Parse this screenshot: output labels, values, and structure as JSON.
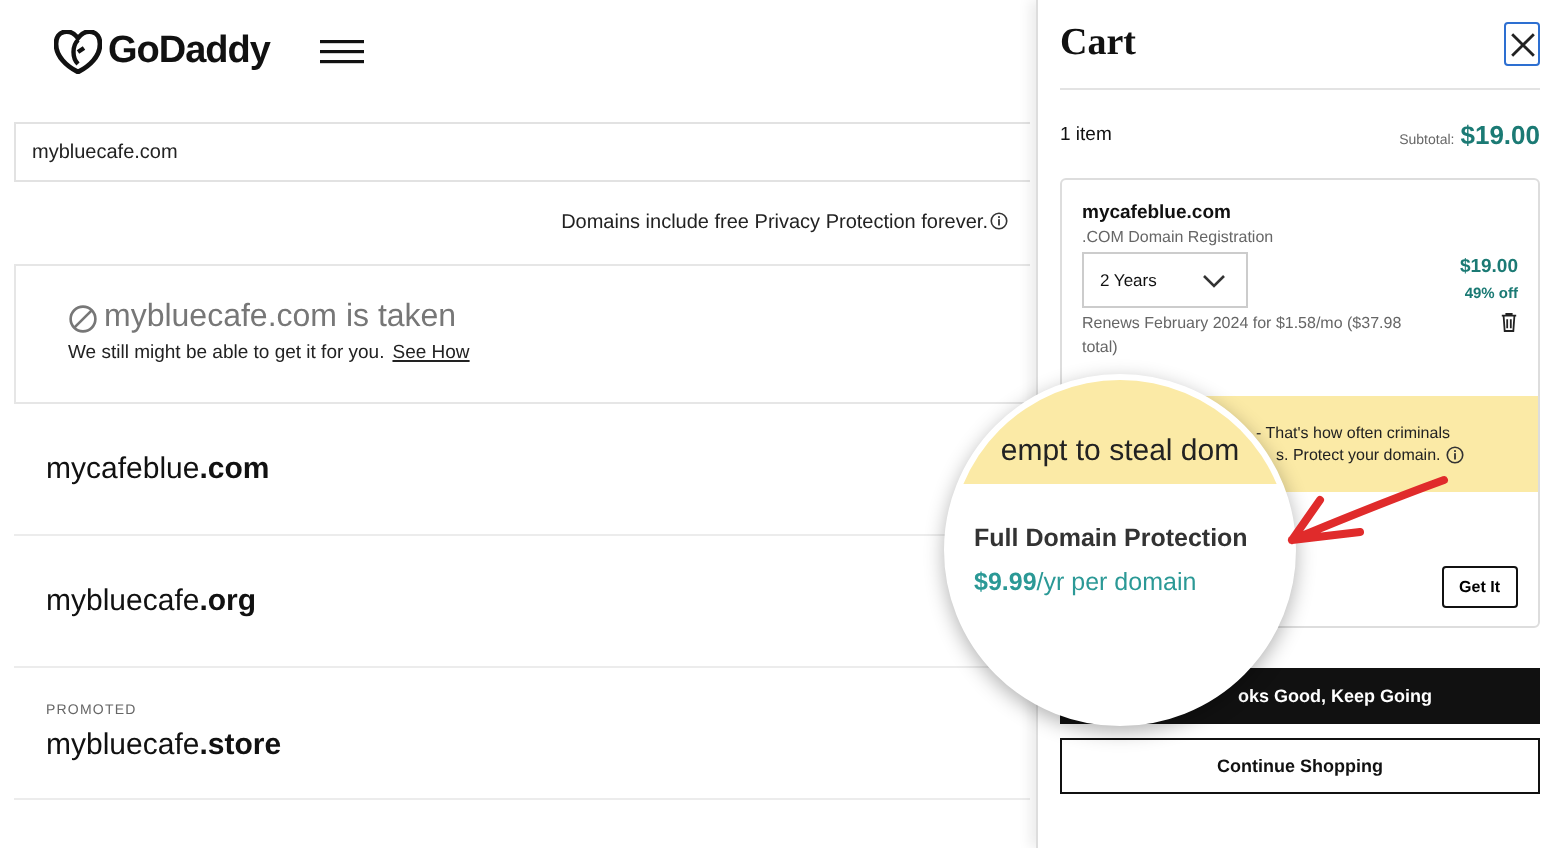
{
  "header": {
    "logo": "GoDaddy"
  },
  "search": {
    "value": "mybluecafe.com"
  },
  "privacy_note": "Domains include free Privacy Protection forever.",
  "taken": {
    "title": "mybluecafe.com is taken",
    "message": "We still might be able to get it for you.",
    "link": "See How"
  },
  "results": [
    {
      "name": "mycafeblue**.com**"
    },
    {
      "name": "mybluecafe**.org**"
    },
    {
      "badge": "PROMOTED",
      "name": "mybluecafe**.store**"
    }
  ],
  "cart": {
    "title": "Cart",
    "item_count": "1 item",
    "subtotal_label": "Subtotal:",
    "subtotal": "$19.00",
    "item": {
      "domain": "mycafeblue.com",
      "type": ".COM Domain Registration",
      "term": "2 Years",
      "price": "$19.00",
      "discount": "49% off",
      "renewal": "Renews February 2024 for $1.58/mo ($37.98 total)"
    },
    "protection": {
      "banner_lines": [
        "- That's how often criminals",
        "s. Protect your domain."
      ],
      "button": "Get It"
    },
    "buttons": [
      {
        "kind": "primary",
        "label": "oks Good, Keep Going"
      },
      {
        "kind": "secondary",
        "label": "Continue Shopping"
      }
    ]
  },
  "magnifier": {
    "banner_text": "empt to steal dom",
    "title": "Full Domain Protection",
    "price": "**$9.99**/yr per domain"
  }
}
